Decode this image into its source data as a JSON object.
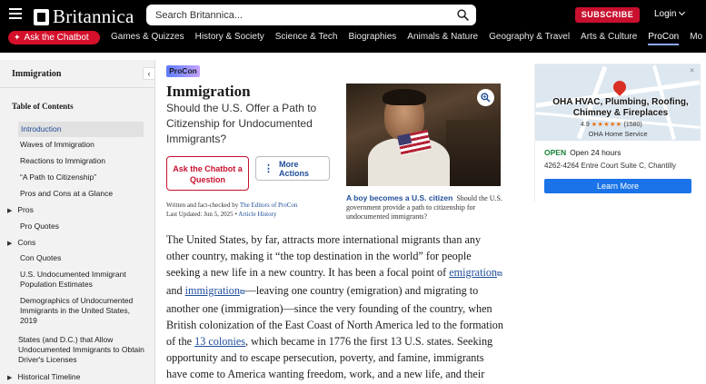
{
  "header": {
    "brand": "Britannica",
    "search_placeholder": "Search Britannica...",
    "subscribe_label": "SUBSCRIBE",
    "login_label": "Login",
    "chatbot_label": "Ask the Chatbot",
    "nav": [
      "Games & Quizzes",
      "History & Society",
      "Science & Tech",
      "Biographies",
      "Animals & Nature",
      "Geography & Travel",
      "Arts & Culture",
      "ProCon",
      "Mo"
    ],
    "active_nav": "ProCon"
  },
  "sidebar": {
    "title": "Immigration",
    "toc_heading": "Table of Contents",
    "items": [
      {
        "label": "Introduction",
        "level": "sub",
        "active": true
      },
      {
        "label": "Waves of Immigration",
        "level": "sub"
      },
      {
        "label": "Reactions to Immigration",
        "level": "sub"
      },
      {
        "label": "“A Path to Citizenship”",
        "level": "sub"
      },
      {
        "label": "Pros and Cons at a Glance",
        "level": "sub"
      },
      {
        "label": "Pros",
        "level": "top"
      },
      {
        "label": "Pro Quotes",
        "level": "sub"
      },
      {
        "label": "Cons",
        "level": "top"
      },
      {
        "label": "Con Quotes",
        "level": "sub"
      },
      {
        "label": "U.S. Undocumented Immigrant Population Estimates",
        "level": "sub"
      },
      {
        "label": "Demographics of Undocumented Immigrants in the United States, 2019",
        "level": "sub"
      },
      {
        "label": "States (and D.C.) that Allow Undocumented Immigrants to Obtain Driver's Licenses",
        "level": "top-plain"
      },
      {
        "label": "Historical Timeline",
        "level": "top"
      }
    ]
  },
  "article": {
    "badge": "ProCon",
    "title": "Immigration",
    "subtitle": "Should the U.S. Offer a Path to Citizenship for Undocumented Immigrants?",
    "chat_button": "Ask the Chatbot a Question",
    "more_actions": "More Actions",
    "byline_prefix": "Written and fact-checked by",
    "byline_author": "The Editors of ProCon",
    "updated": "Last Updated: Jun 5, 2025",
    "history_link": "Article History",
    "caption_title": "A boy becomes a U.S. citizen",
    "caption_text": "Should the U.S. government provide a path to citizenship for undocumented immigrants?",
    "body_1": "The United States, by far, attracts more international migrants than any other country, making it “the top destination in the world” for people seeking a new life in a new country. It has been a focal point of",
    "link_emigration": "emigration",
    "body_and": "and",
    "link_immigration": "immigration",
    "body_2": "—leaving one country (emigration) and migrating to another one (immigration)—since the very founding of the country, when British colonization of the East Coast of North America led to the formation of the",
    "link_colonies": "13 colonies",
    "body_3": ", which became in 1776 the first 13 U.S. states. Seeking opportunity and to escape persecution, poverty, and famine, immigrants have come to America wanting freedom, work, and a new life, and their experiences and dreams have formed an"
  },
  "ad": {
    "business": "OHA HVAC, Plumbing, Roofing, Chimney & Fireplaces",
    "rating": "4.9",
    "stars": "★★★★★",
    "reviews": "(1580)",
    "subtitle": "OHA Home Service",
    "open_label": "OPEN",
    "hours": "Open 24 hours",
    "address": "4262-4264 Entre Court Suite C, Chantilly",
    "button": "Learn More"
  }
}
